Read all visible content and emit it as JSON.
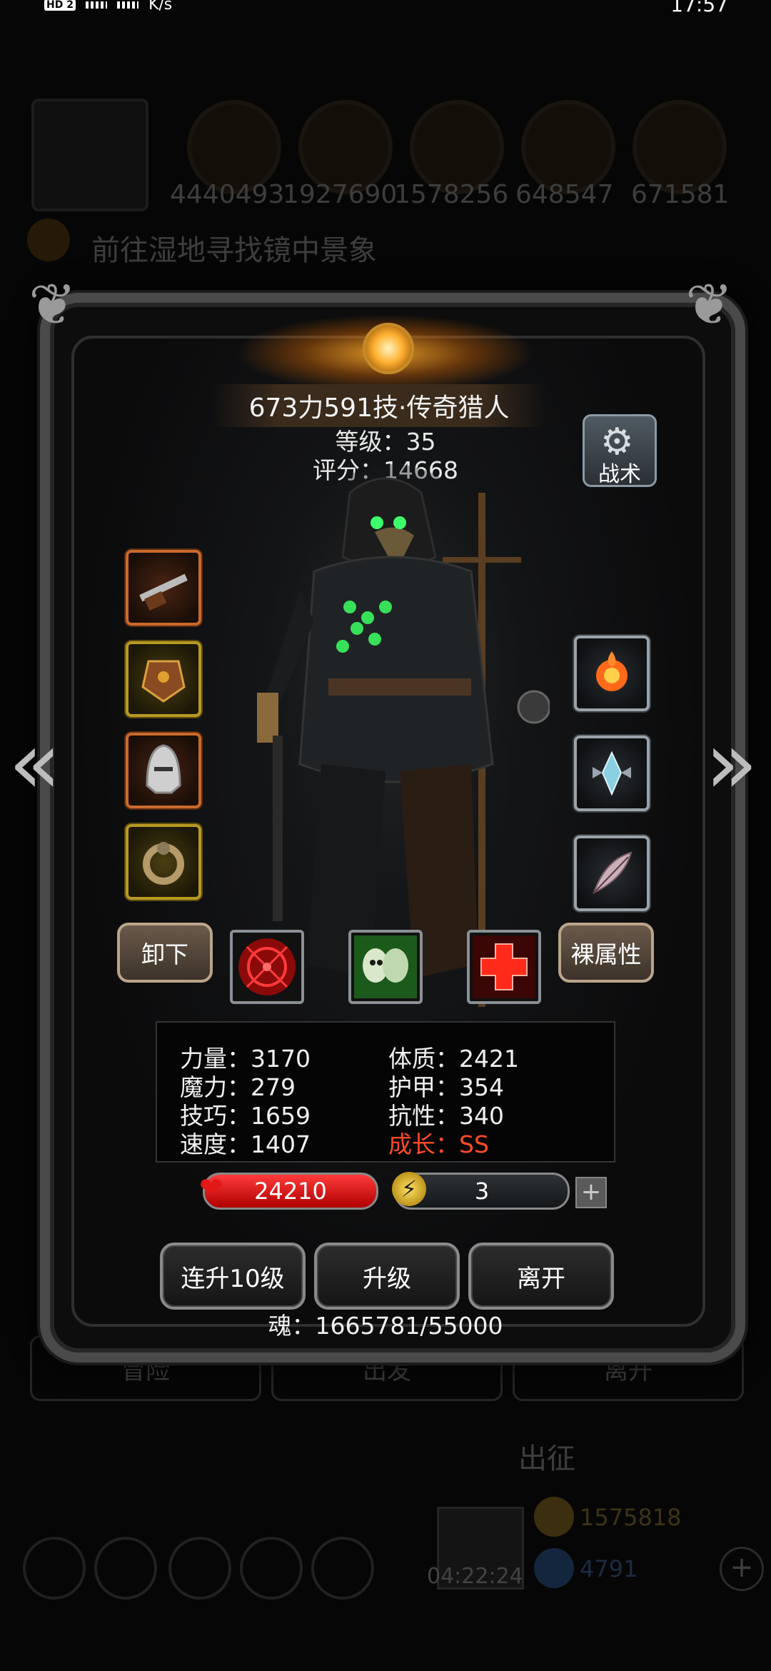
{
  "status_bar": {
    "hd_badge": "HD 2",
    "speed": "K/s",
    "time": "17:57"
  },
  "background": {
    "resources": [
      "4440493",
      "1927690",
      "1578256",
      "648547",
      "671581"
    ],
    "quest_text": "前往湿地寻找镜中景象",
    "bottom_buttons": [
      "冒险",
      "出发",
      "离开"
    ],
    "go_label": "出征",
    "timer": "04:22:24",
    "coins": "1575818",
    "gems": "4791"
  },
  "hero": {
    "name": "673力591技·传奇猎人",
    "level_label": "等级",
    "level": "35",
    "score_label": "评分",
    "score": "14668"
  },
  "tactics_label": "战术",
  "buttons": {
    "unequip": "卸下",
    "bare_attr": "裸属性",
    "level_up_10": "连升10级",
    "level_up": "升级",
    "leave": "离开"
  },
  "stats": {
    "strength": "力量：3170",
    "magic": "魔力：279",
    "skill": "技巧：1659",
    "speed": "速度：1407",
    "constitution": "体质：2421",
    "armor": "护甲：354",
    "resistance": "抗性：340",
    "growth": "成长：SS"
  },
  "hp": "24210",
  "energy": "3",
  "soul": "魂：1665781/55000",
  "colors": {
    "growth": "#ff4a2a",
    "hp_bar": "#d81818",
    "frame_glow": "#ffaa28"
  },
  "icons": {
    "weapon_slot": "musket-icon",
    "armor_slot": "chest-armor-icon",
    "helmet_slot": "helmet-icon",
    "ring_slot": "ring-icon",
    "accessory_1": "fire-orb-icon",
    "accessory_2": "crystal-emblem-icon",
    "accessory_3": "feather-icon",
    "skill_1": "crosshair-icon",
    "skill_2": "twin-skull-icon",
    "skill_3": "red-cross-icon"
  }
}
